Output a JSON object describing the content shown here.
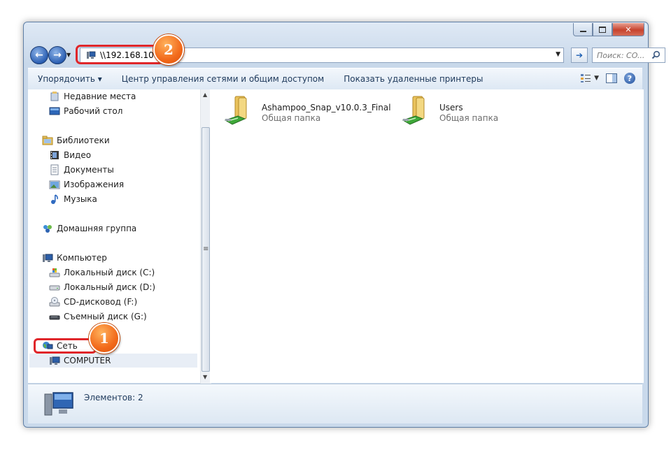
{
  "window": {
    "caption_buttons": {
      "minimize": "▭",
      "maximize": "□",
      "close": "✕"
    }
  },
  "nav": {
    "address": "\\\\192.168.100.2",
    "search_placeholder": "Поиск: CO..."
  },
  "toolbar": {
    "organize": "Упорядочить ▾",
    "network_center": "Центр управления сетями и общим доступом",
    "show_printers": "Показать удаленные принтеры"
  },
  "sidebar": {
    "items": [
      {
        "label": "Недавние места",
        "icon": "recent-places-icon"
      },
      {
        "label": "Рабочий стол",
        "icon": "desktop-icon"
      },
      {
        "label": "Библиотеки",
        "icon": "libraries-icon"
      },
      {
        "label": "Видео",
        "icon": "video-icon"
      },
      {
        "label": "Документы",
        "icon": "documents-icon"
      },
      {
        "label": "Изображения",
        "icon": "pictures-icon"
      },
      {
        "label": "Музыка",
        "icon": "music-icon"
      },
      {
        "label": "Домашняя группа",
        "icon": "homegroup-icon"
      },
      {
        "label": "Компьютер",
        "icon": "computer-icon"
      },
      {
        "label": "Локальный диск (C:)",
        "icon": "system-drive-icon"
      },
      {
        "label": "Локальный диск (D:)",
        "icon": "hard-drive-icon"
      },
      {
        "label": "CD-дисковод (F:)",
        "icon": "cd-drive-icon"
      },
      {
        "label": "Съемный диск (G:)",
        "icon": "removable-drive-icon"
      },
      {
        "label": "Сеть",
        "icon": "network-icon"
      },
      {
        "label": "COMPUTER",
        "icon": "network-computer-icon"
      }
    ]
  },
  "content": {
    "folders": [
      {
        "name": "Ashampoo_Snap_v10.0.3_Final",
        "type": "Общая папка"
      },
      {
        "name": "Users",
        "type": "Общая папка"
      }
    ]
  },
  "status": {
    "items_count": "Элементов: 2"
  },
  "annotations": {
    "badge1": "1",
    "badge2": "2"
  },
  "colors": {
    "annotation_red": "#e0262a",
    "badge_orange": "#f26a1b",
    "toolbar_text": "#1e395b"
  }
}
